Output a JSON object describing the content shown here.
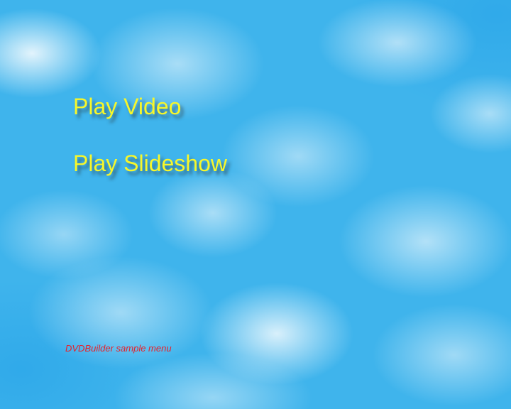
{
  "menu": {
    "items": [
      {
        "label": "Play Video"
      },
      {
        "label": "Play Slideshow"
      }
    ],
    "caption": "DVDBuilder sample menu"
  },
  "colors": {
    "menu_text": "#f7f72a",
    "caption_text": "#e8202a",
    "sky_background": "#3fb4ec"
  }
}
